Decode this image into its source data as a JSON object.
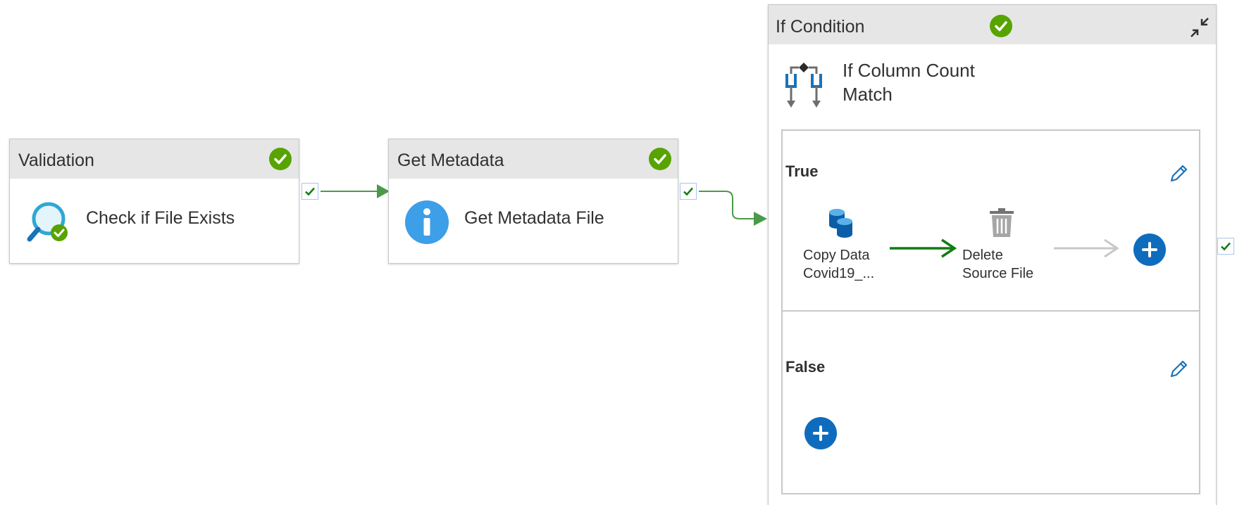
{
  "activities": {
    "validation": {
      "type": "Validation",
      "name": "Check if File Exists",
      "status": "succeeded"
    },
    "get_metadata": {
      "type": "Get Metadata",
      "name": "Get Metadata File",
      "status": "succeeded"
    },
    "if_condition": {
      "type": "If Condition",
      "name_line1": "If Column Count",
      "name_line2": "Match",
      "status": "succeeded",
      "true_branch": {
        "label": "True",
        "activities": [
          {
            "name_line1": "Copy Data",
            "name_line2": "Covid19_..."
          },
          {
            "name_line1": "Delete",
            "name_line2": "Source File"
          }
        ]
      },
      "false_branch": {
        "label": "False"
      }
    }
  },
  "colors": {
    "success": "#57a300",
    "connector_success": "#107c10",
    "add_button": "#0f6cbd",
    "header": "#e6e6e6"
  }
}
